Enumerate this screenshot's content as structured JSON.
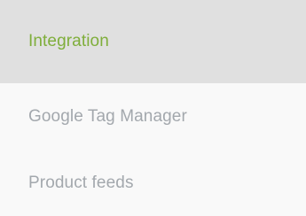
{
  "menu": {
    "items": [
      {
        "label": "Integration",
        "active": true
      },
      {
        "label": "Google Tag Manager",
        "active": false
      },
      {
        "label": "Product feeds",
        "active": false
      }
    ]
  },
  "colors": {
    "active_text": "#7fae3b",
    "active_bg": "#e0e0e0",
    "inactive_text": "#a3a8ad",
    "menu_bg": "#f9f9f9"
  }
}
